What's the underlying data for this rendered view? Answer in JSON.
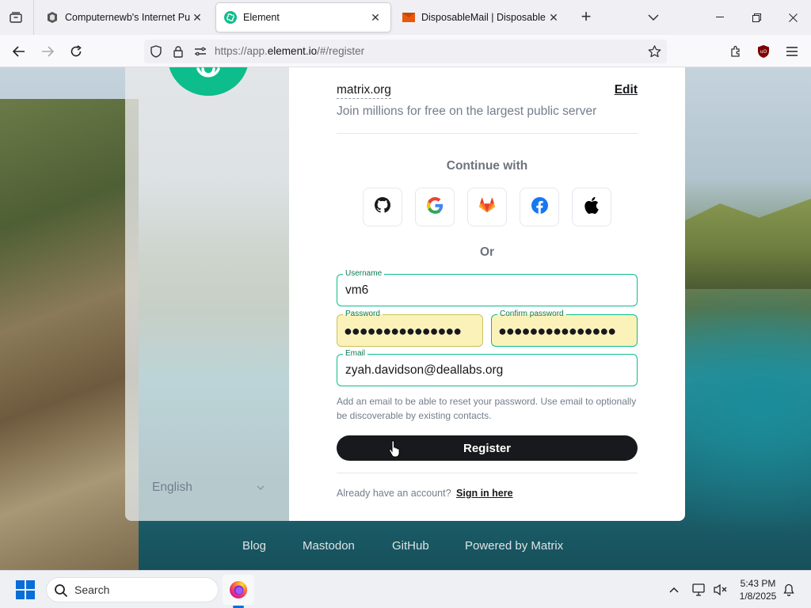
{
  "browser": {
    "tabs": [
      {
        "title": "Computernewb's Internet Pub H",
        "icon": "pub-hub-icon",
        "active": false
      },
      {
        "title": "Element",
        "icon": "element-logo-icon",
        "active": true
      },
      {
        "title": "DisposableMail | Disposable Ten",
        "icon": "disposablemail-icon",
        "active": false
      }
    ],
    "url_prefix": "https://app.",
    "url_domain": "element.io",
    "url_path": "/#/register"
  },
  "sidebar": {
    "language": "English"
  },
  "form": {
    "server_name": "matrix.org",
    "edit_label": "Edit",
    "server_description": "Join millions for free on the largest public server",
    "continue_with": "Continue with",
    "sso_providers": [
      "github-icon",
      "google-icon",
      "gitlab-icon",
      "facebook-icon",
      "apple-icon"
    ],
    "or_label": "Or",
    "username_label": "Username",
    "username_value": "vm6",
    "password_label": "Password",
    "password_mask": "●●●●●●●●●●●●●●●",
    "confirm_label": "Confirm password",
    "confirm_mask": "●●●●●●●●●●●●●●●",
    "email_label": "Email",
    "email_value": "zyah.davidson@deallabs.org",
    "email_help": "Add an email to be able to reset your password. Use email to optionally be discoverable by existing contacts.",
    "register_label": "Register",
    "signin_prompt": "Already have an account?",
    "signin_link": "Sign in here"
  },
  "footer": {
    "links": [
      "Blog",
      "Mastodon",
      "GitHub",
      "Powered by Matrix"
    ]
  },
  "taskbar": {
    "search_placeholder": "Search",
    "time": "5:43 PM",
    "date": "1/8/2025"
  },
  "colors": {
    "element_green": "#0dbd8b",
    "autofill_yellow": "#fbf2ba",
    "button_dark": "#17191c"
  }
}
